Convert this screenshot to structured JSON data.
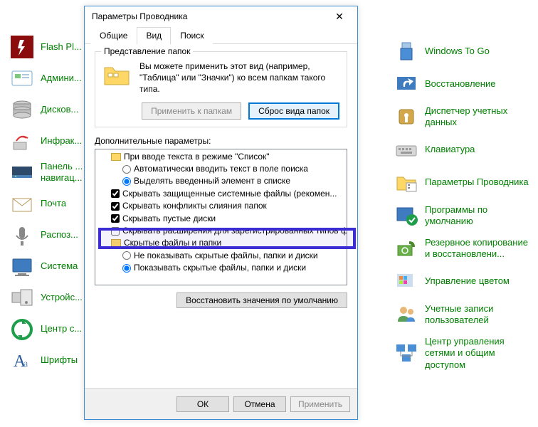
{
  "cp_left": [
    {
      "label": "Flash Pl...",
      "name": "flash-player"
    },
    {
      "label": "Админи...",
      "name": "admin"
    },
    {
      "label": "Дисков...",
      "name": "disk-spaces"
    },
    {
      "label": "Инфрак...",
      "name": "infrared"
    },
    {
      "label": "Панель ...",
      "name": "panel"
    },
    {
      "label": "навигац...",
      "name": "navigation"
    },
    {
      "label": "Почта",
      "name": "mail"
    },
    {
      "label": "Распоз...",
      "name": "speech-recog"
    },
    {
      "label": "Система",
      "name": "system"
    },
    {
      "label": "Устройс...",
      "name": "devices"
    },
    {
      "label": "Центр с...",
      "name": "sync-center"
    },
    {
      "label": "Шрифты",
      "name": "fonts"
    }
  ],
  "cp_right": [
    {
      "label": "Windows To Go",
      "name": "windows-to-go"
    },
    {
      "label": "Восстановление",
      "name": "recovery"
    },
    {
      "label": "Диспетчер учетных данных",
      "name": "credential-manager"
    },
    {
      "label": "Клавиатура",
      "name": "keyboard"
    },
    {
      "label": "Параметры Проводника",
      "name": "explorer-options"
    },
    {
      "label": "Программы по умолчанию",
      "name": "default-programs"
    },
    {
      "label": "Резервное копирование и восстановлени...",
      "name": "backup-restore"
    },
    {
      "label": "Управление цветом",
      "name": "color-management"
    },
    {
      "label": "Учетные записи пользователей",
      "name": "user-accounts"
    },
    {
      "label": "Центр управления сетями и общим доступом",
      "name": "network-center"
    }
  ],
  "dialog": {
    "title": "Параметры Проводника",
    "tabs": {
      "general": "Общие",
      "view": "Вид",
      "search": "Поиск"
    },
    "folder_views": {
      "title": "Представление папок",
      "text": "Вы можете применить этот вид (например, \"Таблица\" или \"Значки\") ко всем папкам такого типа.",
      "apply_btn": "Применить к папкам",
      "reset_btn": "Сброс вида папок"
    },
    "advanced_label": "Дополнительные параметры:",
    "advanced": [
      {
        "type": "folder",
        "text": "При вводе текста в режиме \"Список\"",
        "indent": 1
      },
      {
        "type": "radio",
        "checked": false,
        "text": "Автоматически вводить текст в поле поиска",
        "indent": 2
      },
      {
        "type": "radio",
        "checked": true,
        "text": "Выделять введенный элемент в списке",
        "indent": 2
      },
      {
        "type": "check",
        "checked": true,
        "text": "Скрывать защищенные системные файлы (рекомен...",
        "indent": 1
      },
      {
        "type": "check",
        "checked": true,
        "text": "Скрывать конфликты слияния папок",
        "indent": 1
      },
      {
        "type": "check",
        "checked": true,
        "text": "Скрывать пустые диски",
        "indent": 1
      },
      {
        "type": "check",
        "checked": false,
        "text": "Скрывать расширения для зарегистрированных типов файлов",
        "indent": 1,
        "highlight": true
      },
      {
        "type": "folder",
        "text": "Скрытые файлы и папки",
        "indent": 1
      },
      {
        "type": "radio",
        "checked": false,
        "text": "Не показывать скрытые файлы, папки и диски",
        "indent": 2
      },
      {
        "type": "radio",
        "checked": true,
        "text": "Показывать скрытые файлы, папки и диски",
        "indent": 2
      }
    ],
    "restore_btn": "Восстановить значения по умолчанию",
    "footer": {
      "ok": "ОК",
      "cancel": "Отмена",
      "apply": "Применить"
    }
  }
}
